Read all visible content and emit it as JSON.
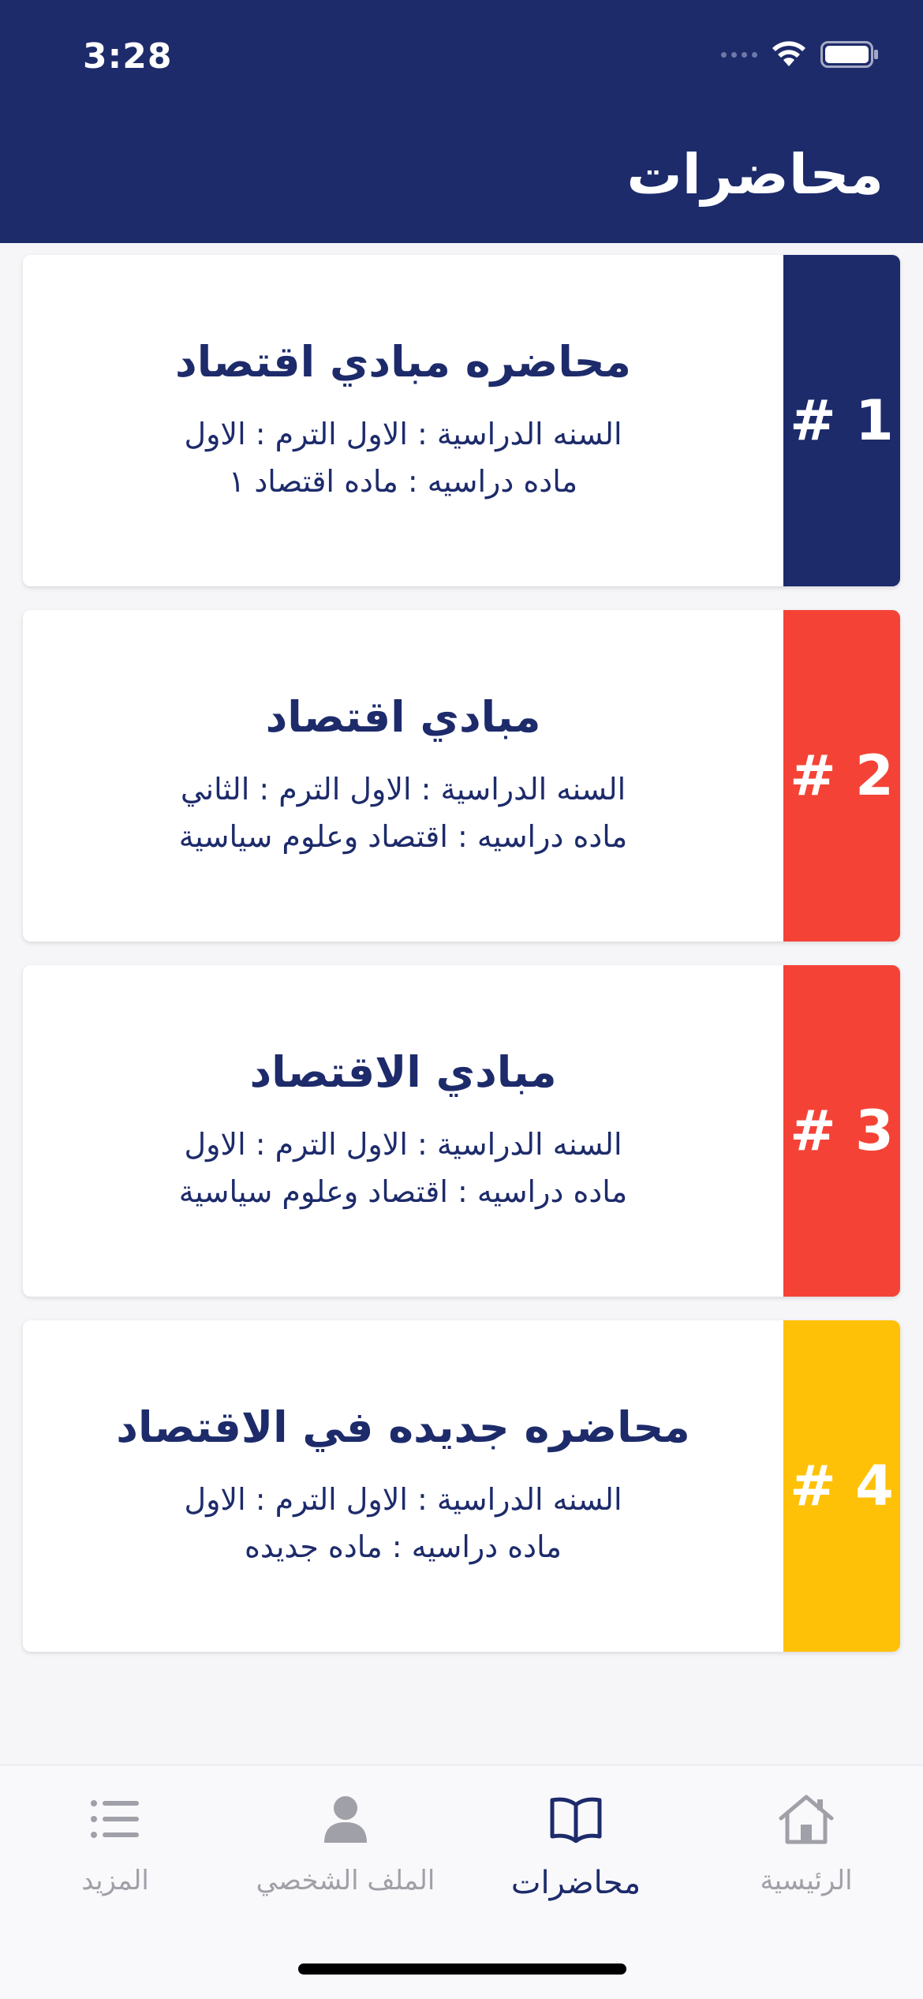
{
  "status_bar": {
    "time": "3:28"
  },
  "header": {
    "title": "محاضرات"
  },
  "colors": {
    "brand": "#1d2b6b",
    "red": "#f44336",
    "yellow": "#ffc107",
    "tab_inactive": "#a0a0a8"
  },
  "lectures": [
    {
      "badge": "# 1",
      "title": "محاضره مبادي اقتصاد",
      "year_term": "السنه الدراسية : الاول الترم : الاول",
      "subject": "ماده دراسيه : ماده اقتصاد ١",
      "color": "#1d2b6b"
    },
    {
      "badge": "# 2",
      "title": "مبادي اقتصاد",
      "year_term": "السنه الدراسية : الاول الترم : الثاني",
      "subject": "ماده دراسيه : اقتصاد وعلوم سياسية",
      "color": "#f44336"
    },
    {
      "badge": "# 3",
      "title": "مبادي الاقتصاد",
      "year_term": "السنه الدراسية : الاول الترم : الاول",
      "subject": "ماده دراسيه : اقتصاد وعلوم سياسية",
      "color": "#f44336"
    },
    {
      "badge": "# 4",
      "title": "محاضره جديده في الاقتصاد",
      "year_term": "السنه الدراسية : الاول الترم : الاول",
      "subject": "ماده دراسيه : ماده جديده",
      "color": "#ffc107"
    }
  ],
  "tabs": {
    "more": {
      "label": "المزيد",
      "icon": "list-icon"
    },
    "profile": {
      "label": "الملف الشخصي",
      "icon": "person-icon"
    },
    "lectures": {
      "label": "محاضرات",
      "icon": "book-icon"
    },
    "home": {
      "label": "الرئيسية",
      "icon": "home-icon"
    }
  }
}
